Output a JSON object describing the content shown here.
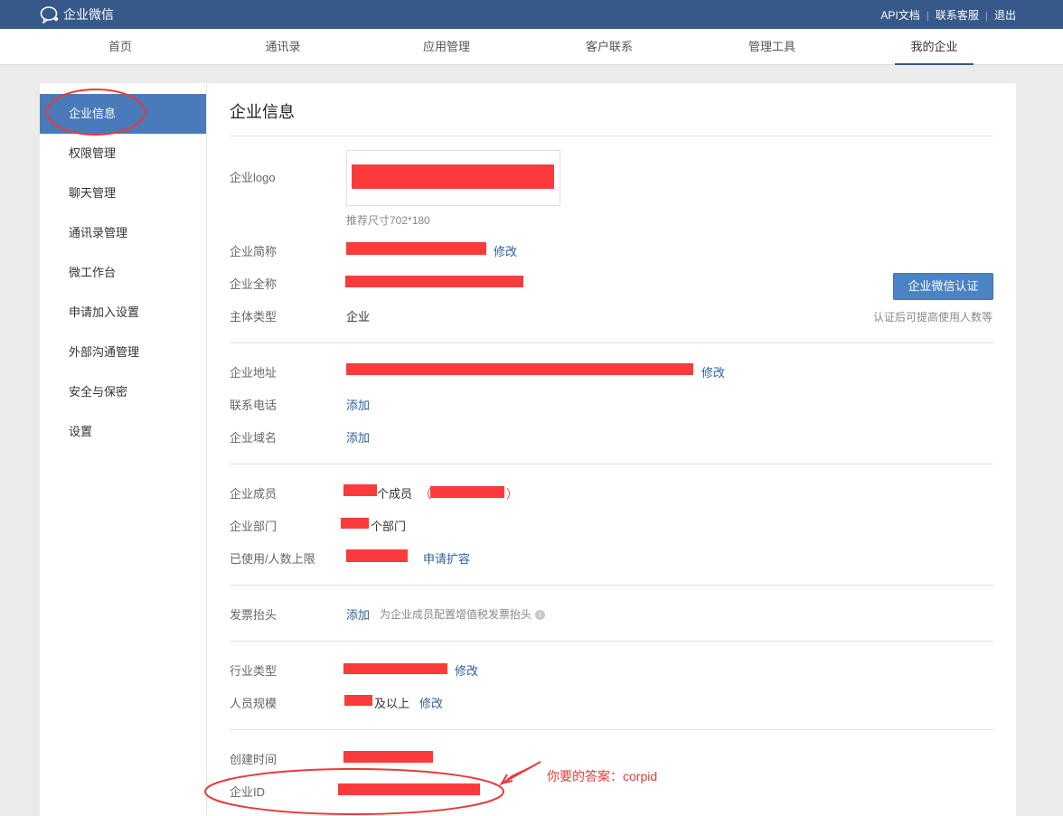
{
  "topbar": {
    "brand": "企业微信",
    "links": [
      "API文档",
      "联系客服",
      "退出"
    ]
  },
  "nav": {
    "items": [
      "首页",
      "通讯录",
      "应用管理",
      "客户联系",
      "管理工具",
      "我的企业"
    ],
    "active": "我的企业"
  },
  "sidebar": {
    "items": [
      "企业信息",
      "权限管理",
      "聊天管理",
      "通讯录管理",
      "微工作台",
      "申请加入设置",
      "外部沟通管理",
      "安全与保密",
      "设置"
    ],
    "active": "企业信息"
  },
  "content": {
    "title": "企业信息",
    "logo_label": "企业logo",
    "logo_hint": "推荐尺寸702*180",
    "short_name_label": "企业简称",
    "edit_label": "修改",
    "full_name_label": "企业全称",
    "subject_type_label": "主体类型",
    "subject_type_value": "企业",
    "cert_button": "企业微信认证",
    "cert_hint": "认证后可提高使用人数等",
    "address_label": "企业地址",
    "phone_label": "联系电话",
    "add_label": "添加",
    "domain_label": "企业域名",
    "members_label": "企业成员",
    "members_suffix": "个成员",
    "paren_open": "（",
    "paren_close": "）",
    "departments_label": "企业部门",
    "departments_suffix": "个部门",
    "limit_label": "已使用/人数上限",
    "expand_link": "申请扩容",
    "invoice_label": "发票抬头",
    "invoice_hint": "为企业成员配置增值税发票抬头",
    "info_icon_glyph": "i",
    "industry_label": "行业类型",
    "scale_label": "人员规模",
    "scale_suffix": "及以上",
    "created_label": "创建时间",
    "corp_id_label": "企业ID"
  },
  "annotation": {
    "answer_text": "你要的答案：corpid",
    "color": "#e63b3b"
  }
}
